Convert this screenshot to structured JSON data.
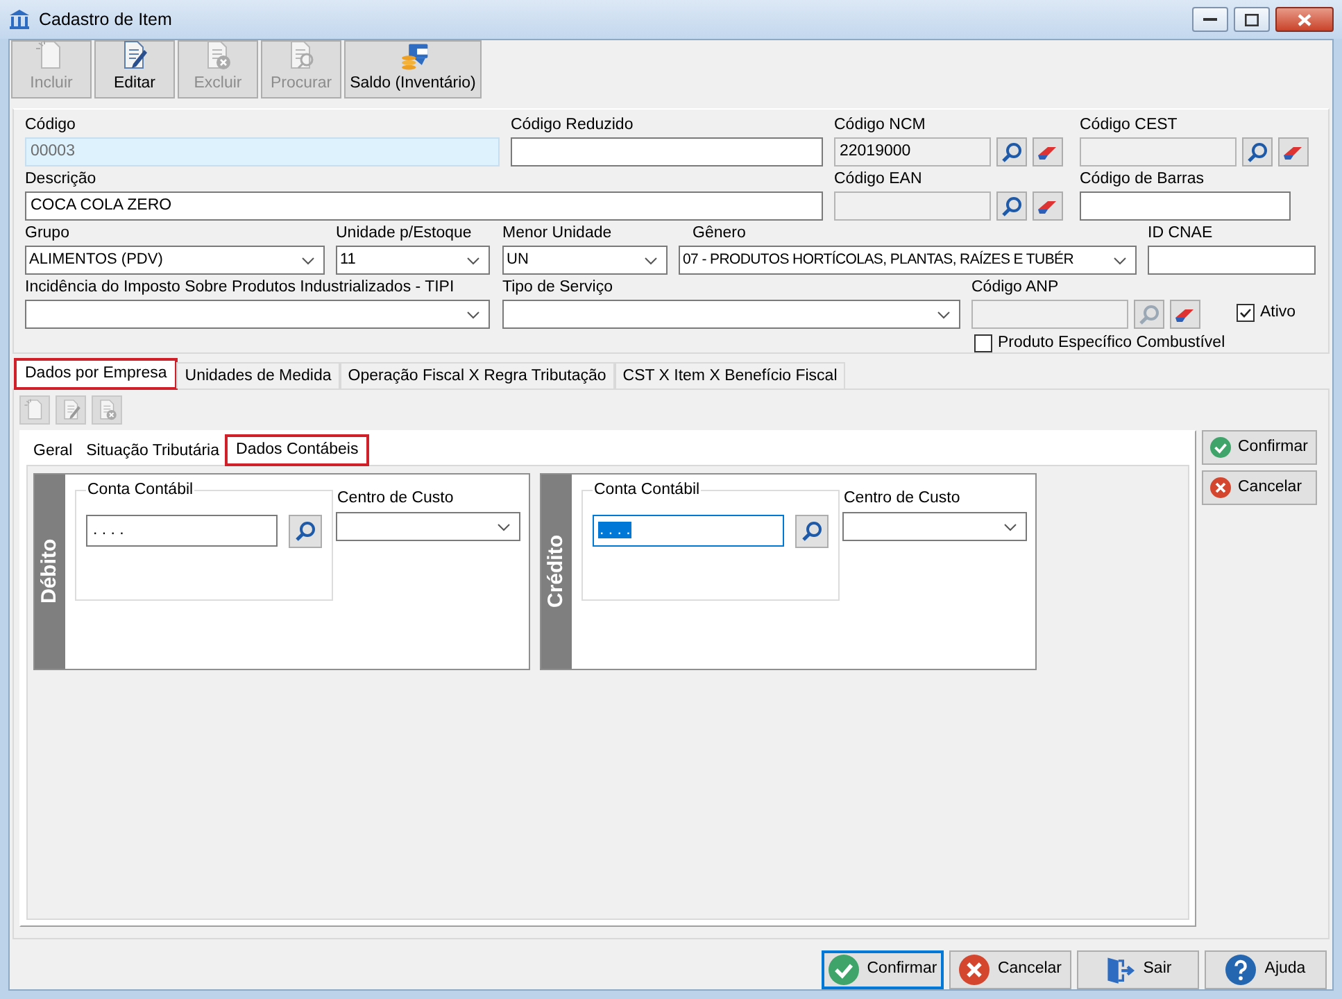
{
  "window": {
    "title": "Cadastro de Item"
  },
  "toolbar": [
    {
      "label": "Incluir",
      "kind": "new",
      "disabled": true
    },
    {
      "label": "Editar",
      "kind": "edit",
      "disabled": false
    },
    {
      "label": "Excluir",
      "kind": "delete",
      "disabled": true
    },
    {
      "label": "Procurar",
      "kind": "find",
      "disabled": true
    },
    {
      "label": "Saldo (Inventário)",
      "kind": "balance",
      "disabled": false
    }
  ],
  "form_rows": [
    [
      {
        "label": "Código",
        "kind": "text",
        "value": "00003",
        "disabled": false,
        "readonly": true
      },
      {
        "label": "Código Reduzido",
        "kind": "text",
        "disabled": false,
        "readonly": false
      },
      {
        "label": "Código NCM",
        "kind": "lookup",
        "value": "22019000",
        "disabled": true,
        "readonly": false,
        "buttons": [
          {
            "kind": "search",
            "disabled": false
          },
          {
            "kind": "eraser",
            "disabled": false
          }
        ]
      },
      {
        "label": "Código CEST",
        "kind": "lookup",
        "disabled": true,
        "readonly": false,
        "buttons": [
          {
            "kind": "search",
            "disabled": false
          },
          {
            "kind": "eraser",
            "disabled": false
          }
        ]
      }
    ],
    [
      {
        "label": "Descrição",
        "kind": "text",
        "value": "COCA COLA ZERO",
        "disabled": false,
        "readonly": false
      },
      {
        "label": "Código EAN",
        "kind": "lookup",
        "disabled": true,
        "readonly": false,
        "buttons": [
          {
            "kind": "search",
            "disabled": false
          },
          {
            "kind": "eraser",
            "disabled": false
          }
        ]
      },
      {
        "label": "Código de Barras",
        "kind": "text",
        "disabled": false,
        "readonly": false
      }
    ],
    [
      {
        "label": "Grupo",
        "kind": "select",
        "value": "ALIMENTOS (PDV)"
      },
      {
        "label": "Unidade p/Estoque",
        "kind": "select",
        "value": "11"
      },
      {
        "label": "Menor Unidade",
        "kind": "select",
        "value": "UN"
      },
      {
        "label": "Gênero",
        "kind": "select",
        "value": "07 - PRODUTOS HORTÍCOLAS, PLANTAS, RAÍZES E TUBÉR"
      },
      {
        "label": "ID CNAE",
        "kind": "text",
        "disabled": false,
        "readonly": false
      }
    ],
    [
      {
        "label": "Incidência do Imposto Sobre Produtos Industrializados - TIPI",
        "kind": "select"
      },
      {
        "label": "Tipo de Serviço",
        "kind": "select"
      },
      {
        "label": "Código ANP",
        "kind": "lookup",
        "disabled": true,
        "readonly": false,
        "buttons": [
          {
            "kind": "search",
            "disabled": true
          },
          {
            "kind": "eraser",
            "disabled": false
          }
        ]
      }
    ]
  ],
  "checkboxes": [
    {
      "label": "Ativo",
      "checked": true
    },
    {
      "label": "Produto Específico Combustível",
      "checked": false
    }
  ],
  "tabs": [
    {
      "label": "Dados por Empresa",
      "selected": true,
      "highlighted": true
    },
    {
      "label": "Unidades de Medida",
      "selected": false,
      "highlighted": false
    },
    {
      "label": "Operação Fiscal X Regra Tributação",
      "selected": false,
      "highlighted": false
    },
    {
      "label": "CST X Item X Benefício Fiscal",
      "selected": false,
      "highlighted": false
    }
  ],
  "tab_toolbar": [
    {
      "kind": "new",
      "disabled": true
    },
    {
      "kind": "edit",
      "disabled": true
    },
    {
      "kind": "delete",
      "disabled": true
    }
  ],
  "subtabs": [
    {
      "label": "Geral",
      "selected": false,
      "highlighted": false
    },
    {
      "label": "Situação Tributária",
      "selected": false,
      "highlighted": false
    },
    {
      "label": "Dados Contábeis",
      "selected": true,
      "highlighted": true
    }
  ],
  "accounts": [
    {
      "title": "Débito",
      "account_label": "Conta Contábil",
      "account_value": ". . . .",
      "focused": false,
      "cost_center_label": "Centro de Custo"
    },
    {
      "title": "Crédito",
      "account_label": "Conta Contábil",
      "account_value": ". . . .",
      "focused": true,
      "cost_center_label": "Centro de Custo"
    }
  ],
  "side_buttons": [
    {
      "label": "Confirmar",
      "kind": "confirm"
    },
    {
      "label": "Cancelar",
      "kind": "cancel"
    }
  ],
  "footer_buttons": [
    {
      "label": "Confirmar",
      "kind": "confirm",
      "focused": true
    },
    {
      "label": "Cancelar",
      "kind": "cancel",
      "focused": false
    },
    {
      "label": "Sair",
      "kind": "exit",
      "focused": false
    },
    {
      "label": "Ajuda",
      "kind": "help",
      "focused": false
    }
  ]
}
